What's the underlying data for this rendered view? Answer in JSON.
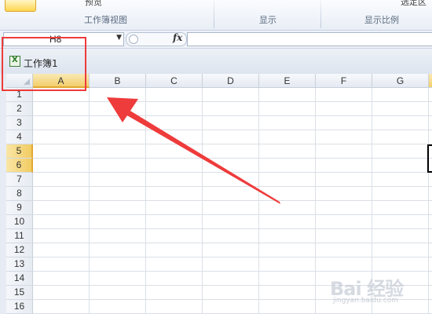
{
  "ribbon": {
    "cut_label_left": "预览",
    "cut_label_right": "选定区",
    "groups": [
      "工作簿视图",
      "显示",
      "显示比例"
    ]
  },
  "formula_bar": {
    "name_box_value": "H8",
    "dropdown_glyph": "▼",
    "fx_label": "fx",
    "formula_value": ""
  },
  "workbook": {
    "title": "工作簿1",
    "icon": "excel-workbook-icon"
  },
  "grid": {
    "columns": [
      "A",
      "B",
      "C",
      "D",
      "E",
      "F",
      "G"
    ],
    "rows": [
      "1",
      "2",
      "3",
      "4",
      "5",
      "6",
      "7",
      "8",
      "9",
      "10",
      "11",
      "12",
      "13",
      "14",
      "15",
      "16"
    ],
    "active_column": "A",
    "highlighted_rows": [
      "5",
      "6"
    ]
  },
  "annotation": {
    "highlight_color": "#ee3b3b",
    "arrow_color": "#ee3b3b"
  },
  "watermark": {
    "main": "Bai  经验",
    "sub": "jingyan.baidu.com"
  },
  "colors": {
    "header_highlight": "#f2cf6c",
    "gridline": "#dadfe6",
    "ribbon_bg": "#e9eef6"
  }
}
